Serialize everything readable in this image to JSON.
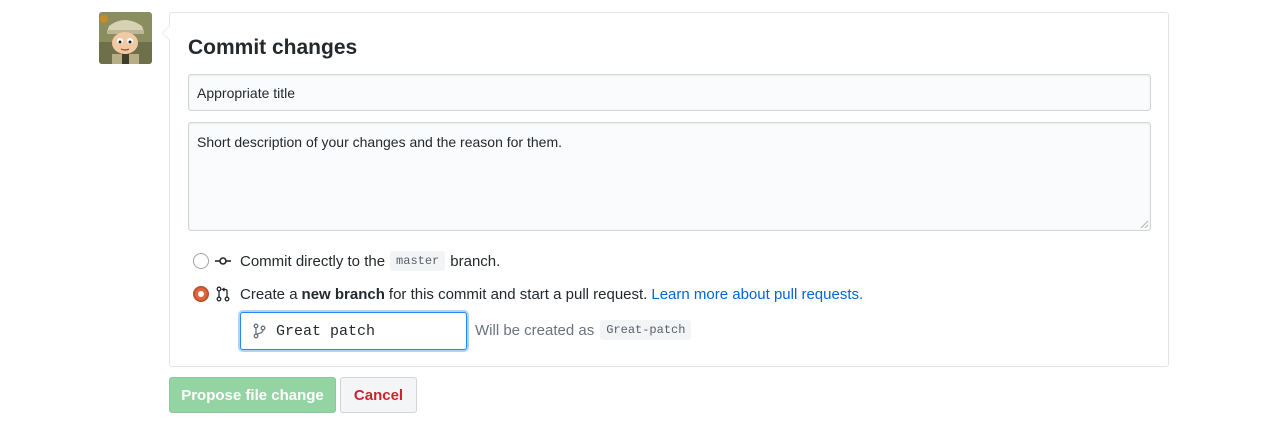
{
  "commit_form": {
    "heading": "Commit changes",
    "title_input_value": "Appropriate title",
    "description_value": "Short description of your changes and the reason for them.",
    "option_direct": {
      "prefix": "Commit directly to the",
      "branch": "master",
      "suffix": "branch.",
      "selected": false,
      "icon": "git-commit-icon"
    },
    "option_new_branch": {
      "prefix": "Create a",
      "bold": "new branch",
      "suffix": "for this commit and start a pull request.",
      "link": "Learn more about pull requests.",
      "selected": true,
      "icon": "git-pull-request-icon"
    },
    "branch_name_value": "Great patch",
    "branch_icon": "git-branch-icon",
    "created_as_label": "Will be created as",
    "created_as_value": "Great-patch"
  },
  "actions": {
    "propose_label": "Propose file change",
    "cancel_label": "Cancel"
  },
  "colors": {
    "propose_bg": "#94d3a2",
    "cancel_text": "#cb2431",
    "link": "#0366d6",
    "radio_selected": "#e0653b",
    "focus_border": "#2188ff"
  }
}
